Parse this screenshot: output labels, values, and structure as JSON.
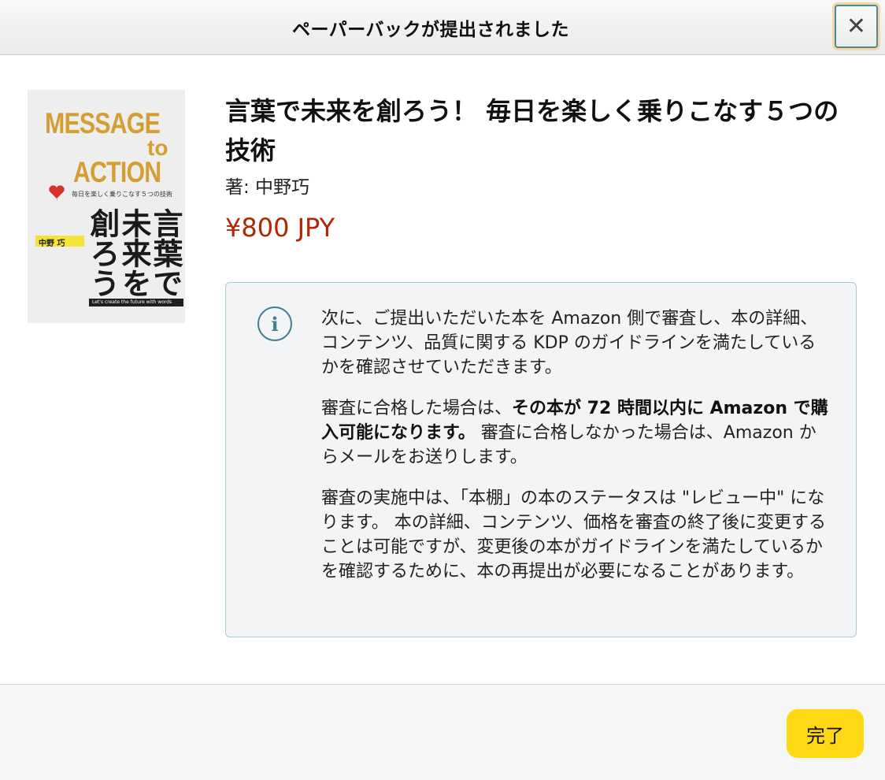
{
  "dialog": {
    "title": "ペーパーバックが提出されました",
    "close_icon": "close-icon"
  },
  "cover": {
    "line_message": "MESSAGE",
    "line_to": "to",
    "line_action": "ACTION",
    "subtitle": "毎日を楽しく乗りこなす５つの技術",
    "jp_col1": "言葉で",
    "jp_col2": "未来を",
    "jp_col3": "創ろう",
    "author": "中野 巧",
    "tagline": "Let's create the future with words",
    "accent_color": "#d59e32"
  },
  "book": {
    "title": "言葉で未来を創ろう！ 毎日を楽しく乗りこなす５つの技術",
    "author": "著: 中野巧",
    "price": "¥800 JPY",
    "price_color": "#b12704"
  },
  "info": {
    "icon": "info-icon",
    "para1": "次に、ご提出いただいた本を Amazon 側で審査し、本の詳細、コンテンツ、品質に関する KDP のガイドラインを満たしているかを確認させていただきます。",
    "para2_pre": "審査に合格した場合は、",
    "para2_bold": "その本が 72 時間以内に Amazon で購入可能になります。",
    "para2_post": " 審査に合格しなかった場合は、Amazon からメールをお送りします。",
    "para3": "審査の実施中は、「本棚」の本のステータスは \"レビュー中\" になります。 本の詳細、コンテンツ、価格を審査の終了後に変更することは可能ですが、変更後の本がガイドラインを満たしているかを確認するために、本の再提出が必要になることがあります。"
  },
  "footer": {
    "done_label": "完了",
    "done_color": "#ffd814"
  }
}
